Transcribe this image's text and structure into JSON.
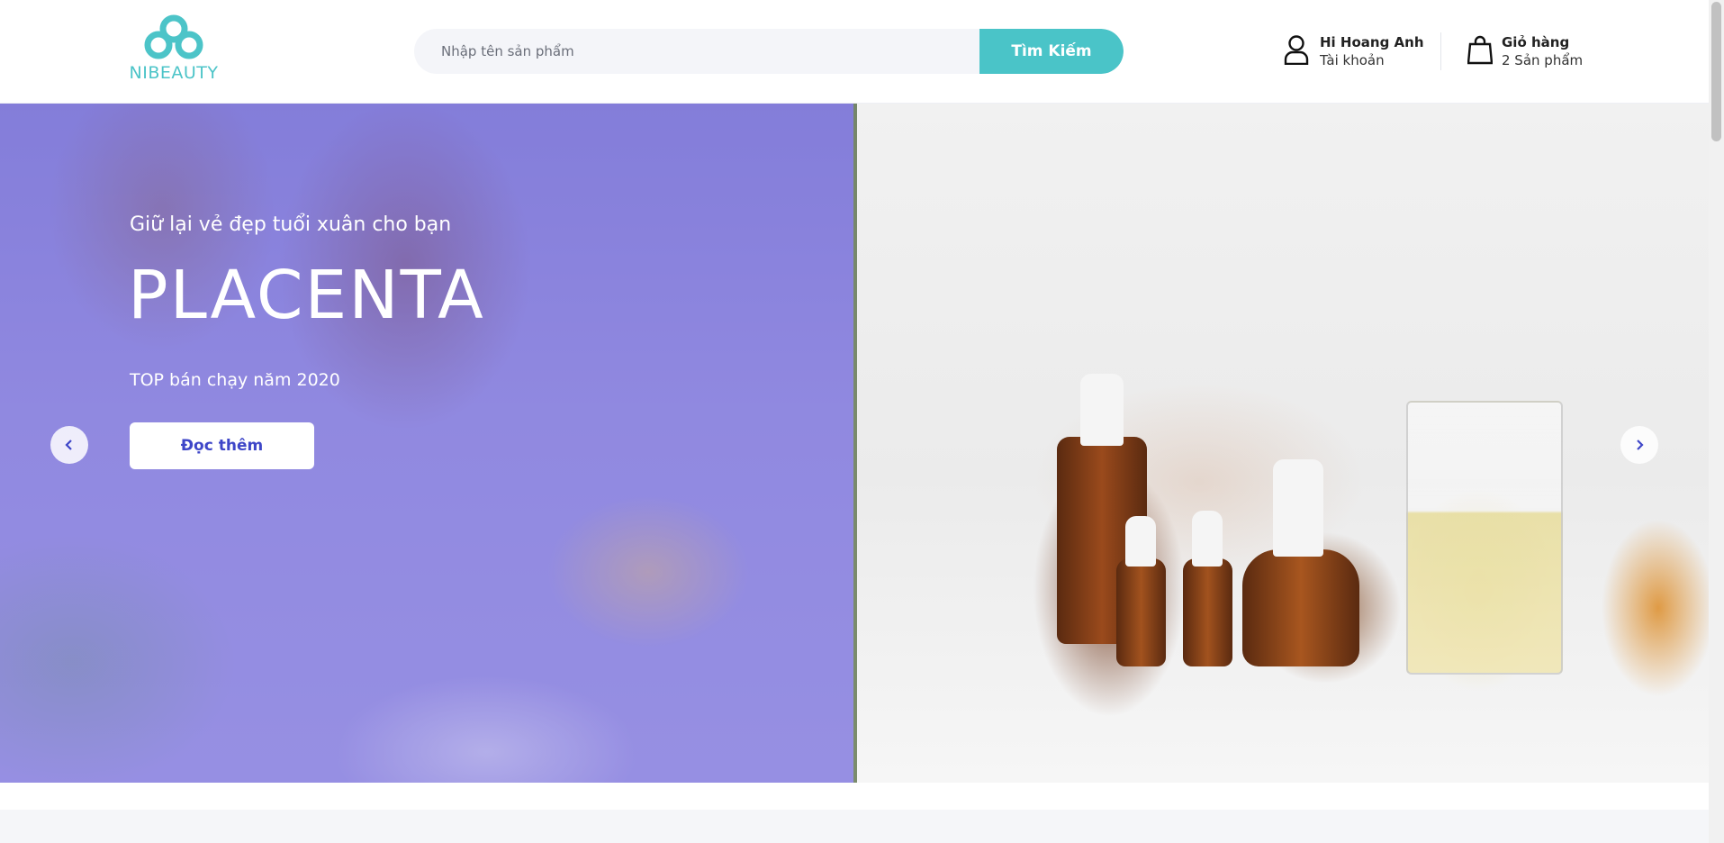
{
  "brand": {
    "name": "NIBEAUTY",
    "accent": "#4ac4c8"
  },
  "search": {
    "placeholder": "Nhập tên sản phẩm",
    "button_label": "Tìm Kiếm"
  },
  "account": {
    "greeting": "Hi Hoang Anh",
    "label": "Tài khoản",
    "icon": "user-icon"
  },
  "cart": {
    "title": "Giỏ hàng",
    "count_label": "2 Sản phẩm",
    "icon": "shopping-bag-icon"
  },
  "hero": {
    "subtitle": "Giữ lại vẻ đẹp tuổi xuân cho bạn",
    "title": "PLACENTA",
    "tagline": "TOP bán chạy năm 2020",
    "cta_label": "Đọc thêm",
    "cta_color": "#3e46c8",
    "prev_icon": "chevron-left-icon",
    "next_icon": "chevron-right-icon"
  }
}
